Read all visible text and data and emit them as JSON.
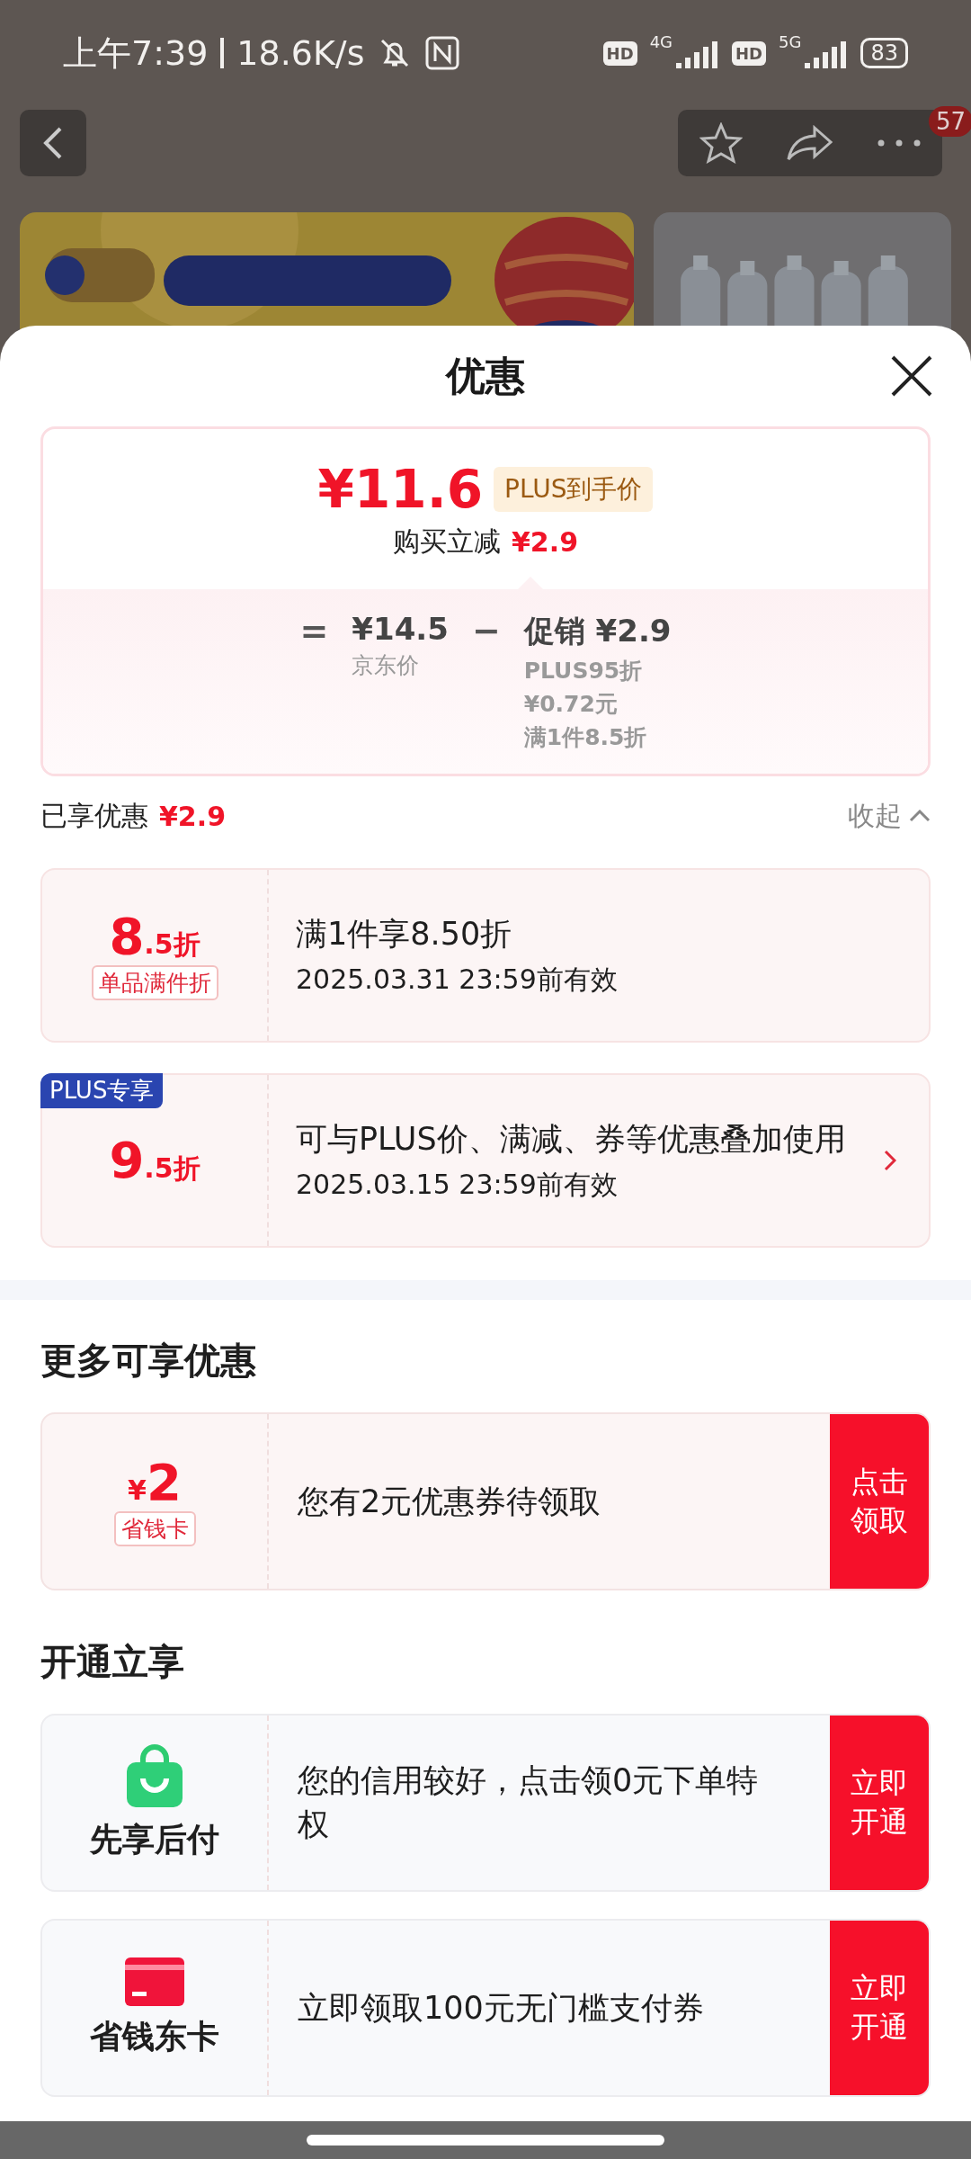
{
  "status_bar": {
    "time": "上午7:39",
    "speed": "18.6K/s",
    "sim_1": {
      "hd": "HD",
      "network": "4G"
    },
    "sim_2": {
      "hd": "HD",
      "network": "5G"
    },
    "battery": "83"
  },
  "top_nav": {
    "badge": "57"
  },
  "sheet": {
    "title": "优惠",
    "price_card": {
      "price": "¥11.6",
      "price_tag": "PLUS到手价",
      "discount_label": "购买立减",
      "discount": "¥2.9",
      "equals": "=",
      "base_price": "¥14.5",
      "base_label": "京东价",
      "minus": "−",
      "promo": "促销 ¥2.9",
      "promo_lines": [
        "PLUS95折",
        "¥0.72元",
        "满1件8.5折"
      ]
    },
    "saved": {
      "label": "已享优惠",
      "amount": "¥2.9",
      "toggle": "收起",
      "expanded": true
    },
    "coupons": [
      {
        "big": "8",
        "small": ".5折",
        "tag": "单品满件折",
        "title": "满1件享8.50折",
        "validity": "2025.03.31 23:59前有效",
        "chevron": false
      },
      {
        "badge": "PLUS专享",
        "big": "9",
        "small": ".5折",
        "title": "可与PLUS价、满减、券等优惠叠加使用",
        "validity": "2025.03.15 23:59前有效",
        "chevron": true
      }
    ],
    "more": {
      "title": "更多可享优惠",
      "offers": [
        {
          "currency": "¥",
          "amount": "2",
          "tag": "省钱卡",
          "text": "您有2元优惠券待领取",
          "button": "点击领取"
        }
      ]
    },
    "open": {
      "title": "开通立享",
      "offers": [
        {
          "kind": "paylater",
          "label": "先享后付",
          "text": "您的信用较好，点击领0元下单特权",
          "button": "立即开通"
        },
        {
          "kind": "savings_card",
          "label": "省钱东卡",
          "text": "立即领取100元无门槛支付券",
          "button": "立即开通"
        }
      ]
    }
  }
}
